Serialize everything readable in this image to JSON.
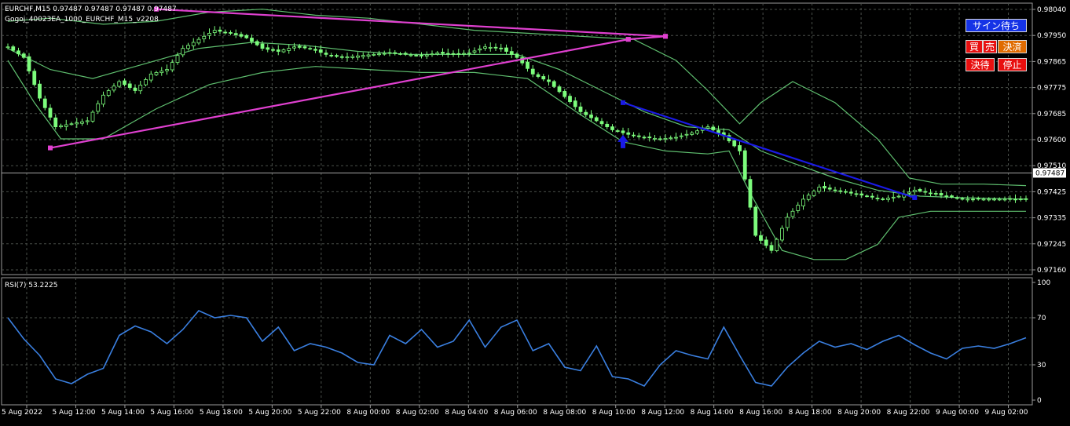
{
  "header": {
    "symbol_line": "EURCHF,M15  0.97487 0.97487 0.97487 0.97487",
    "ea_name": "Gogoj_40023EA_1000_EURCHF_M15_v2208"
  },
  "buttons": {
    "signal_wait": "サイン待ち",
    "buy": "買",
    "sell": "売",
    "settle": "決済",
    "settle_wait": "決待",
    "stop": "停止"
  },
  "colors": {
    "background": "#000000",
    "grid": "#4a4f4a",
    "candle": "#7cfc7c",
    "bollinger": "#5fbf6f",
    "trend_magenta": "#e040d0",
    "trend_blue": "#1a1ae6",
    "rsi_line": "#3a7fe0",
    "axis_text": "#ffffff"
  },
  "chart_data": [
    {
      "type": "candlestick",
      "title": "EURCHF,M15",
      "price_axis_ticks": [
        "0.98040",
        "0.97950",
        "0.97865",
        "0.97775",
        "0.97685",
        "0.97600",
        "0.97510",
        "0.97425",
        "0.97335",
        "0.97245",
        "0.97160"
      ],
      "ylim": [
        0.9715,
        0.9805
      ],
      "current_price": "0.97487",
      "x_ticks": [
        "5 Aug 2022",
        "5 Aug 12:00",
        "5 Aug 14:00",
        "5 Aug 16:00",
        "5 Aug 18:00",
        "5 Aug 20:00",
        "5 Aug 22:00",
        "8 Aug 00:00",
        "8 Aug 02:00",
        "8 Aug 04:00",
        "8 Aug 06:00",
        "8 Aug 08:00",
        "8 Aug 10:00",
        "8 Aug 12:00",
        "8 Aug 14:00",
        "8 Aug 16:00",
        "8 Aug 18:00",
        "8 Aug 20:00",
        "8 Aug 22:00",
        "9 Aug 00:00",
        "9 Aug 02:00"
      ],
      "close_path": [
        [
          0,
          0.97905
        ],
        [
          3,
          0.9787
        ],
        [
          6,
          0.97735
        ],
        [
          9,
          0.9764
        ],
        [
          12,
          0.9765
        ],
        [
          15,
          0.9766
        ],
        [
          18,
          0.97745
        ],
        [
          21,
          0.9779
        ],
        [
          24,
          0.9776
        ],
        [
          27,
          0.97815
        ],
        [
          30,
          0.9783
        ],
        [
          33,
          0.979
        ],
        [
          36,
          0.9793
        ],
        [
          39,
          0.9796
        ],
        [
          42,
          0.9795
        ],
        [
          45,
          0.97935
        ],
        [
          48,
          0.979
        ],
        [
          51,
          0.9789
        ],
        [
          54,
          0.97905
        ],
        [
          57,
          0.979
        ],
        [
          60,
          0.9788
        ],
        [
          63,
          0.9787
        ],
        [
          66,
          0.97875
        ],
        [
          69,
          0.9788
        ],
        [
          72,
          0.97885
        ],
        [
          75,
          0.9788
        ],
        [
          78,
          0.97875
        ],
        [
          81,
          0.97885
        ],
        [
          84,
          0.9788
        ],
        [
          87,
          0.97885
        ],
        [
          90,
          0.97905
        ],
        [
          93,
          0.979
        ],
        [
          96,
          0.9787
        ],
        [
          99,
          0.97815
        ],
        [
          102,
          0.9779
        ],
        [
          105,
          0.9774
        ],
        [
          108,
          0.9769
        ],
        [
          111,
          0.9766
        ],
        [
          114,
          0.9763
        ],
        [
          117,
          0.97615
        ],
        [
          120,
          0.97605
        ],
        [
          123,
          0.976
        ],
        [
          126,
          0.97605
        ],
        [
          129,
          0.9762
        ],
        [
          132,
          0.9764
        ],
        [
          135,
          0.9761
        ],
        [
          138,
          0.9756
        ],
        [
          141,
          0.9728
        ],
        [
          144,
          0.9723
        ],
        [
          147,
          0.9734
        ],
        [
          150,
          0.974
        ],
        [
          153,
          0.9744
        ],
        [
          156,
          0.9743
        ],
        [
          159,
          0.9742
        ],
        [
          162,
          0.9741
        ],
        [
          165,
          0.974
        ],
        [
          168,
          0.9741
        ],
        [
          171,
          0.9743
        ],
        [
          174,
          0.9742
        ],
        [
          177,
          0.9741
        ],
        [
          180,
          0.974
        ],
        [
          183,
          0.974
        ],
        [
          186,
          0.974
        ],
        [
          189,
          0.974
        ],
        [
          192,
          0.974
        ]
      ],
      "bollinger_bands": {
        "upper": [
          [
            0,
            0.9799
          ],
          [
            8,
            0.98
          ],
          [
            18,
            0.9798
          ],
          [
            28,
            0.9799
          ],
          [
            38,
            0.9802
          ],
          [
            48,
            0.9803
          ],
          [
            58,
            0.9801
          ],
          [
            68,
            0.98
          ],
          [
            78,
            0.9798
          ],
          [
            88,
            0.9796
          ],
          [
            98,
            0.9795
          ],
          [
            108,
            0.9794
          ],
          [
            118,
            0.9793
          ],
          [
            126,
            0.9786
          ],
          [
            132,
            0.9776
          ],
          [
            138,
            0.9765
          ],
          [
            142,
            0.9772
          ],
          [
            148,
            0.9779
          ],
          [
            156,
            0.9772
          ],
          [
            164,
            0.976
          ],
          [
            170,
            0.9747
          ],
          [
            176,
            0.9745
          ],
          [
            184,
            0.9745
          ],
          [
            192,
            0.97445
          ]
        ],
        "middle": [
          [
            0,
            0.979
          ],
          [
            8,
            0.9783
          ],
          [
            16,
            0.978
          ],
          [
            26,
            0.9785
          ],
          [
            36,
            0.979
          ],
          [
            46,
            0.9792
          ],
          [
            56,
            0.9791
          ],
          [
            66,
            0.9789
          ],
          [
            76,
            0.9788
          ],
          [
            86,
            0.9788
          ],
          [
            96,
            0.9788
          ],
          [
            104,
            0.9783
          ],
          [
            112,
            0.9776
          ],
          [
            120,
            0.9769
          ],
          [
            128,
            0.9764
          ],
          [
            136,
            0.9763
          ],
          [
            142,
            0.9756
          ],
          [
            148,
            0.9752
          ],
          [
            156,
            0.9747
          ],
          [
            164,
            0.9743
          ],
          [
            172,
            0.9741
          ],
          [
            180,
            0.97405
          ],
          [
            192,
            0.974
          ]
        ],
        "lower": [
          [
            0,
            0.9786
          ],
          [
            5,
            0.9772
          ],
          [
            10,
            0.976
          ],
          [
            18,
            0.976
          ],
          [
            28,
            0.977
          ],
          [
            38,
            0.9778
          ],
          [
            48,
            0.9782
          ],
          [
            58,
            0.9784
          ],
          [
            68,
            0.9783
          ],
          [
            78,
            0.9782
          ],
          [
            88,
            0.9782
          ],
          [
            98,
            0.978
          ],
          [
            108,
            0.9768
          ],
          [
            116,
            0.9759
          ],
          [
            124,
            0.9756
          ],
          [
            132,
            0.9755
          ],
          [
            136,
            0.9756
          ],
          [
            140,
            0.9742
          ],
          [
            146,
            0.9723
          ],
          [
            152,
            0.972
          ],
          [
            158,
            0.972
          ],
          [
            164,
            0.9725
          ],
          [
            168,
            0.9734
          ],
          [
            174,
            0.9736
          ],
          [
            182,
            0.9736
          ],
          [
            192,
            0.9736
          ]
        ]
      },
      "trendlines": [
        {
          "color": "magenta",
          "from": [
            8,
            0.9757
          ],
          "to": [
            117,
            0.9793
          ]
        },
        {
          "color": "magenta",
          "from": [
            28,
            0.9803
          ],
          "to": [
            124,
            0.9794
          ]
        },
        {
          "color": "magenta",
          "from": [
            117,
            0.9793
          ],
          "to": [
            124,
            0.9794
          ]
        },
        {
          "color": "blue",
          "from": [
            116,
            0.9772
          ],
          "to": [
            171,
            0.97405
          ]
        }
      ],
      "arrow_up_at": [
        116,
        0.9759
      ]
    },
    {
      "type": "line",
      "title": "RSI(7) 53.2225",
      "ylim": [
        0,
        100
      ],
      "y_ticks": [
        "100",
        "70",
        "30",
        "0"
      ],
      "levels": [
        70,
        30
      ],
      "values": [
        [
          0,
          70
        ],
        [
          3,
          52
        ],
        [
          6,
          38
        ],
        [
          9,
          18
        ],
        [
          12,
          14
        ],
        [
          15,
          22
        ],
        [
          18,
          27
        ],
        [
          21,
          55
        ],
        [
          24,
          63
        ],
        [
          27,
          58
        ],
        [
          30,
          48
        ],
        [
          33,
          60
        ],
        [
          36,
          76
        ],
        [
          39,
          70
        ],
        [
          42,
          72
        ],
        [
          45,
          70
        ],
        [
          48,
          50
        ],
        [
          51,
          62
        ],
        [
          54,
          42
        ],
        [
          57,
          48
        ],
        [
          60,
          45
        ],
        [
          63,
          40
        ],
        [
          66,
          32
        ],
        [
          69,
          30
        ],
        [
          72,
          55
        ],
        [
          75,
          48
        ],
        [
          78,
          60
        ],
        [
          81,
          45
        ],
        [
          84,
          50
        ],
        [
          87,
          68
        ],
        [
          90,
          45
        ],
        [
          93,
          62
        ],
        [
          96,
          68
        ],
        [
          99,
          42
        ],
        [
          102,
          48
        ],
        [
          105,
          28
        ],
        [
          108,
          25
        ],
        [
          111,
          46
        ],
        [
          114,
          20
        ],
        [
          117,
          18
        ],
        [
          120,
          12
        ],
        [
          123,
          30
        ],
        [
          126,
          42
        ],
        [
          129,
          38
        ],
        [
          132,
          35
        ],
        [
          135,
          62
        ],
        [
          138,
          38
        ],
        [
          141,
          15
        ],
        [
          144,
          12
        ],
        [
          147,
          28
        ],
        [
          150,
          40
        ],
        [
          153,
          50
        ],
        [
          156,
          45
        ],
        [
          159,
          48
        ],
        [
          162,
          43
        ],
        [
          165,
          50
        ],
        [
          168,
          55
        ],
        [
          171,
          47
        ],
        [
          174,
          40
        ],
        [
          177,
          35
        ],
        [
          180,
          44
        ],
        [
          183,
          46
        ],
        [
          186,
          44
        ],
        [
          189,
          48
        ],
        [
          192,
          53
        ]
      ]
    }
  ]
}
